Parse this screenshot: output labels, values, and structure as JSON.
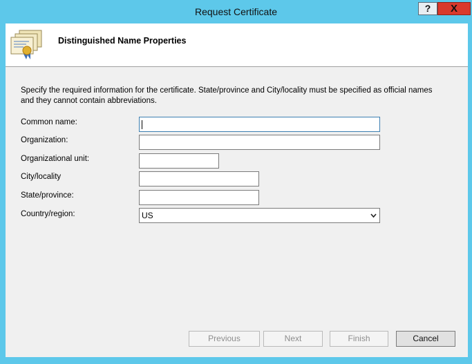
{
  "window": {
    "title": "Request Certificate",
    "help_label": "?",
    "close_label": "X"
  },
  "header": {
    "title": "Distinguished Name Properties"
  },
  "description": "Specify the required information for the certificate. State/province and City/locality must be specified as official names and they cannot contain abbreviations.",
  "fields": {
    "common_name": {
      "label": "Common name:",
      "value": ""
    },
    "organization": {
      "label": "Organization:",
      "value": ""
    },
    "org_unit": {
      "label": "Organizational unit:",
      "value": ""
    },
    "city": {
      "label": "City/locality",
      "value": ""
    },
    "state": {
      "label": "State/province:",
      "value": ""
    },
    "country": {
      "label": "Country/region:",
      "value": "US"
    }
  },
  "buttons": {
    "previous": "Previous",
    "next": "Next",
    "finish": "Finish",
    "cancel": "Cancel"
  },
  "colors": {
    "frame": "#5dc8ea",
    "close": "#d9392b",
    "client": "#f0f0f0"
  }
}
